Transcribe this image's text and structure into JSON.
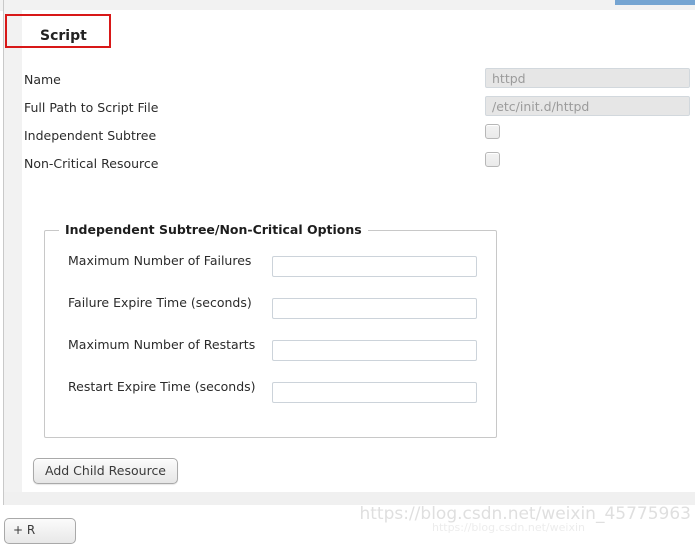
{
  "window": {
    "title": "Script"
  },
  "tab": {
    "active_label": "Script",
    "highlight_color": "#d81818"
  },
  "form": {
    "rows": [
      {
        "label": "Name",
        "control": "text",
        "value": "httpd",
        "disabled": true
      },
      {
        "label": "Full Path to Script File",
        "control": "text",
        "value": "/etc/init.d/httpd",
        "disabled": true
      },
      {
        "label": "Independent Subtree",
        "control": "checkbox",
        "checked": false
      },
      {
        "label": "Non-Critical Resource",
        "control": "checkbox",
        "checked": false
      }
    ]
  },
  "fieldset": {
    "legend": "Independent Subtree/Non-Critical Options",
    "rows": [
      {
        "label": "Maximum Number of Failures",
        "value": ""
      },
      {
        "label": "Failure Expire Time (seconds)",
        "value": ""
      },
      {
        "label": "Maximum Number of Restarts",
        "value": ""
      },
      {
        "label": "Restart Expire Time (seconds)",
        "value": ""
      }
    ]
  },
  "actions": {
    "add_child_resource": "Add Child Resource",
    "clipped_bottom_button": "+ R"
  },
  "watermark": {
    "line1": "https://blog.csdn.net/weixin_45775963",
    "line2": "https://blog.csdn.net/weixin"
  },
  "colors": {
    "accent_blue": "#76a5d2",
    "annotation_red": "#d81818",
    "disabled_field_bg": "#e6e6e6",
    "disabled_field_text": "#9b9b9b"
  }
}
